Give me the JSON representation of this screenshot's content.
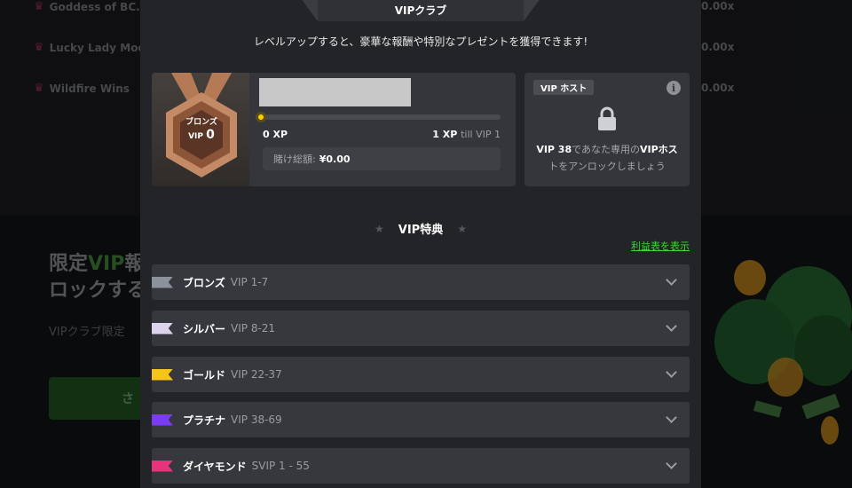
{
  "background": {
    "games": [
      {
        "name": "Goddess of BC.G",
        "multiplier": "0.00x"
      },
      {
        "name": "Lucky Lady Moor",
        "multiplier": "0.00x"
      },
      {
        "name": "Wildfire Wins",
        "multiplier": "0.00x"
      }
    ],
    "promo": {
      "title_part1": "限定",
      "title_green": "VIP",
      "title_part2": "報",
      "title_line2": "ロックする",
      "subtitle": "VIPクラブ限定",
      "button": "さ"
    }
  },
  "modal": {
    "tab_title": "VIPクラブ",
    "subtitle": "レベルアップすると、豪華な報酬や特別なプレゼントを獲得できます!",
    "medal": {
      "tier": "ブロンズ",
      "vip_label": "VIP",
      "level": "0"
    },
    "progress": {
      "current": "0 XP",
      "next_value": "1 XP",
      "next_suffix": "till VIP 1",
      "fraction": 0
    },
    "wager": {
      "label": "賭け総額:",
      "value": "¥0.00"
    },
    "host": {
      "badge": "VIP ホスト",
      "text_bold1": "VIP 38",
      "text1": "であなた専用の",
      "text_bold2": "VIPホス",
      "text2": "トをアンロックしましょう"
    },
    "perks_title": "VIP特典",
    "table_link": "利益表を表示",
    "tiers": [
      {
        "name": "ブロンズ",
        "range": "VIP 1-7",
        "color": "#8c929c"
      },
      {
        "name": "シルバー",
        "range": "VIP 8-21",
        "color": "#dcd4ee"
      },
      {
        "name": "ゴールド",
        "range": "VIP 22-37",
        "color": "#f5c51a"
      },
      {
        "name": "プラチナ",
        "range": "VIP 38-69",
        "color": "#7a3cf2"
      },
      {
        "name": "ダイヤモンド",
        "range": "SVIP 1 - 55",
        "color": "#e8337c"
      }
    ]
  }
}
